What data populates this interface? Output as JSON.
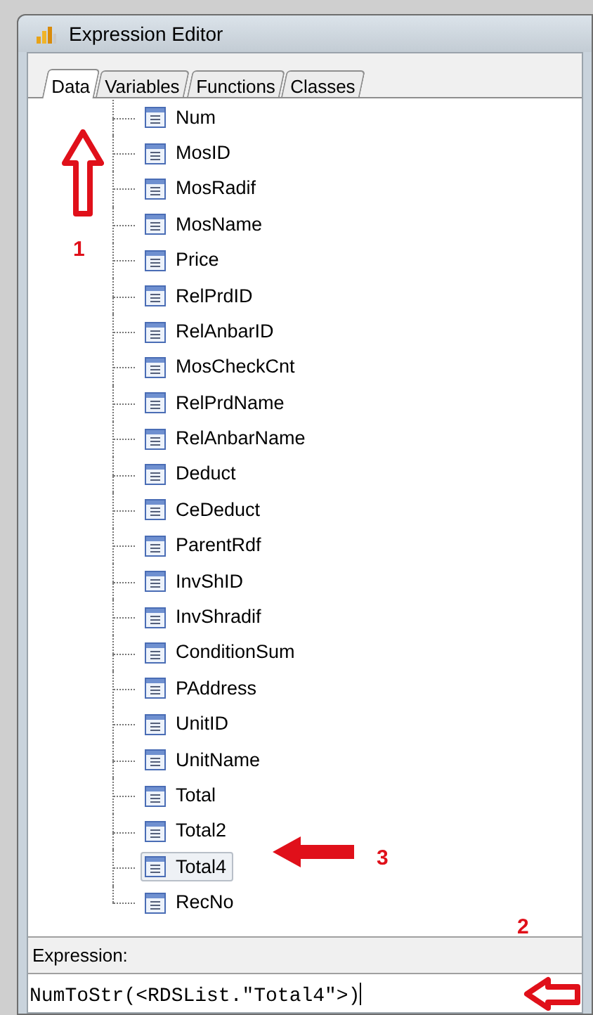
{
  "window": {
    "title": "Expression Editor"
  },
  "tabs": [
    {
      "label": "Data",
      "selected": true
    },
    {
      "label": "Variables",
      "selected": false
    },
    {
      "label": "Functions",
      "selected": false
    },
    {
      "label": "Classes",
      "selected": false
    }
  ],
  "tree": {
    "items": [
      {
        "label": "Num",
        "selected": false
      },
      {
        "label": "MosID",
        "selected": false
      },
      {
        "label": "MosRadif",
        "selected": false
      },
      {
        "label": "MosName",
        "selected": false
      },
      {
        "label": "Price",
        "selected": false
      },
      {
        "label": "RelPrdID",
        "selected": false
      },
      {
        "label": "RelAnbarID",
        "selected": false
      },
      {
        "label": "MosCheckCnt",
        "selected": false
      },
      {
        "label": "RelPrdName",
        "selected": false
      },
      {
        "label": "RelAnbarName",
        "selected": false
      },
      {
        "label": "Deduct",
        "selected": false
      },
      {
        "label": "CeDeduct",
        "selected": false
      },
      {
        "label": "ParentRdf",
        "selected": false
      },
      {
        "label": "InvShID",
        "selected": false
      },
      {
        "label": "InvShradif",
        "selected": false
      },
      {
        "label": "ConditionSum",
        "selected": false
      },
      {
        "label": "PAddress",
        "selected": false
      },
      {
        "label": "UnitID",
        "selected": false
      },
      {
        "label": "UnitName",
        "selected": false
      },
      {
        "label": "Total",
        "selected": false
      },
      {
        "label": "Total2",
        "selected": false
      },
      {
        "label": "Total4",
        "selected": true
      },
      {
        "label": "RecNo",
        "selected": false
      }
    ]
  },
  "expression": {
    "label": "Expression:",
    "value": "NumToStr(<RDSList.\"Total4\">)"
  },
  "annotations": [
    {
      "kind": "up-arrow",
      "number": "1"
    },
    {
      "kind": "left-arrow",
      "number": "3"
    },
    {
      "kind": "outline-left-arrow",
      "number": "2"
    }
  ]
}
